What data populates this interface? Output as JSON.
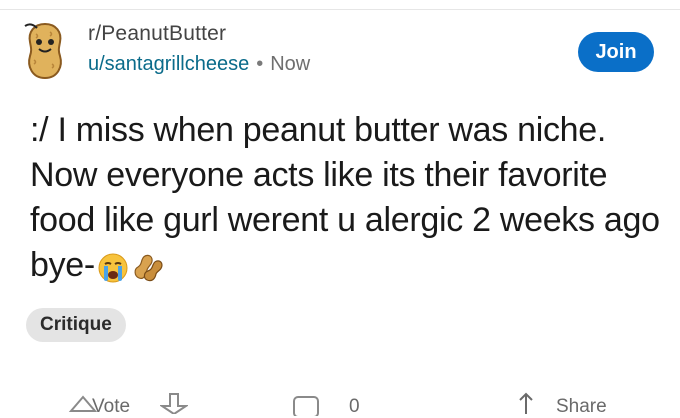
{
  "post": {
    "subreddit": "r/PeanutButter",
    "username": "u/santagrillcheese",
    "separator": "•",
    "timestamp": "Now",
    "join_label": "Join",
    "body_text": ":/ I miss when peanut butter was niche. Now everyone acts like its their favorite food like gurl werent u alergic 2 weeks ago bye-",
    "body_emojis": [
      "crying-face",
      "peanuts"
    ],
    "flair": "Critique"
  },
  "actions": {
    "vote_label": "Vote",
    "comment_count": "0",
    "share_label": "Share"
  },
  "colors": {
    "join_bg": "#0a6fc8",
    "username": "#0a6b8a",
    "flair_bg": "#e4e4e4"
  }
}
